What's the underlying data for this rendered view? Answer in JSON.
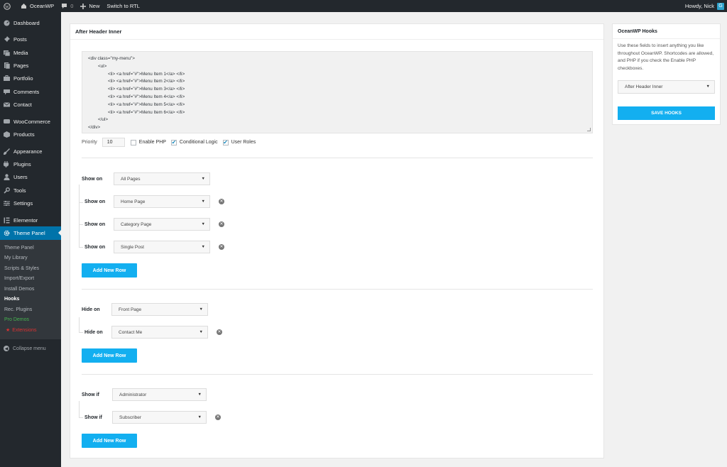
{
  "admin_bar": {
    "site_name": "OceanWP",
    "comments_count": "0",
    "new_label": "New",
    "rtl_label": "Switch to RTL",
    "howdy": "Howdy, Nick",
    "avatar_letter": "G",
    "icons": [
      "wordpress-icon",
      "home-icon",
      "comment-icon",
      "plus-icon"
    ]
  },
  "sidebar": {
    "items": [
      {
        "label": "Dashboard",
        "icon": "dashboard-icon"
      },
      {
        "label": "Posts",
        "icon": "pin-icon"
      },
      {
        "label": "Media",
        "icon": "media-icon"
      },
      {
        "label": "Pages",
        "icon": "pages-icon"
      },
      {
        "label": "Portfolio",
        "icon": "portfolio-icon"
      },
      {
        "label": "Comments",
        "icon": "comment-icon"
      },
      {
        "label": "Contact",
        "icon": "mail-icon"
      },
      {
        "label": "WooCommerce",
        "icon": "woo-icon"
      },
      {
        "label": "Products",
        "icon": "products-icon"
      },
      {
        "label": "Appearance",
        "icon": "brush-icon"
      },
      {
        "label": "Plugins",
        "icon": "plugin-icon"
      },
      {
        "label": "Users",
        "icon": "users-icon"
      },
      {
        "label": "Tools",
        "icon": "wrench-icon"
      },
      {
        "label": "Settings",
        "icon": "settings-icon"
      },
      {
        "label": "Elementor",
        "icon": "elementor-icon"
      },
      {
        "label": "Theme Panel",
        "icon": "gear-icon"
      }
    ],
    "submenu": [
      "Theme Panel",
      "My Library",
      "Scripts & Styles",
      "Import/Export",
      "Install Demos",
      "Hooks",
      "Rec. Plugins",
      "Pro Demos",
      "Extensions"
    ],
    "collapse_label": "Collapse menu"
  },
  "main": {
    "title": "After Header Inner",
    "code_lines": [
      "<div class=\"my-menu\">",
      "        <ul>",
      "                <li> <a href=\"#\">Menu Item 1</a> </li>",
      "                <li> <a href=\"#\">Menu Item 2</a> </li>",
      "                <li> <a href=\"#\">Menu Item 3</a> </li>",
      "                <li> <a href=\"#\">Menu Item 4</a> </li>",
      "                <li> <a href=\"#\">Menu Item 5</a> </li>",
      "                <li> <a href=\"#\">Menu Item 6</a> </li>",
      "        </ul>",
      "</div>"
    ],
    "priority_label": "Priority",
    "priority_value": "10",
    "enable_php_label": "Enable PHP",
    "enable_php_checked": false,
    "conditional_logic_label": "Conditional Logic",
    "conditional_logic_checked": true,
    "user_roles_label": "User Roles",
    "user_roles_checked": true,
    "show_on": {
      "label": "Show on",
      "main_value": "All Pages",
      "rows": [
        "Home Page",
        "Category Page",
        "Single Post"
      ]
    },
    "hide_on": {
      "label": "Hide on",
      "main_value": "Front Page",
      "rows": [
        "Contact Me"
      ]
    },
    "show_if": {
      "label": "Show if",
      "main_value": "Administrator",
      "rows": [
        "Subscriber"
      ]
    },
    "add_row_label": "Add New Row"
  },
  "side_panel": {
    "title": "OceanWP Hooks",
    "description": "Use these fields to insert anything you like throughout OceanWP. Shortcodes are allowed, and PHP if you check the Enable PHP checkboxes.",
    "select_value": "After Header Inner",
    "save_label": "Save Hooks"
  },
  "colors": {
    "accent": "#13aff0",
    "admin_bg": "#23282d",
    "active_menu": "#0073aa"
  }
}
